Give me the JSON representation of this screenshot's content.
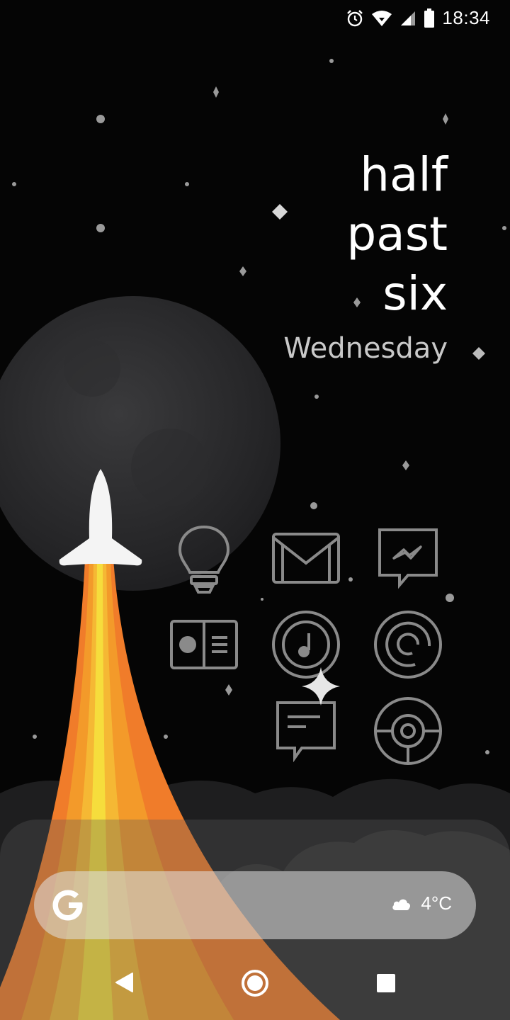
{
  "status_bar": {
    "time": "18:34",
    "icons": [
      "alarm-icon",
      "wifi-icon",
      "cellular-signal-icon",
      "battery-icon"
    ]
  },
  "clock_widget": {
    "lines": [
      "half",
      "past",
      "six"
    ],
    "day": "Wednesday"
  },
  "apps": [
    {
      "name": "keep-notes-icon"
    },
    {
      "name": "gmail-icon"
    },
    {
      "name": "messenger-icon"
    },
    {
      "name": "contacts-card-icon"
    },
    {
      "name": "music-icon"
    },
    {
      "name": "podcasts-icon"
    },
    {
      "name": "messages-icon"
    },
    {
      "name": "camera-icon"
    }
  ],
  "search_bar": {
    "logo": "google-g-logo",
    "weather_icon": "cloud-icon",
    "temperature": "4°C"
  },
  "nav_bar": {
    "buttons": [
      "back-button",
      "home-button",
      "recents-button"
    ]
  },
  "colors": {
    "background": "#050505",
    "icon_stroke": "#8a8a8a",
    "flame_outer": "#f07c2a",
    "flame_mid": "#f5a623",
    "flame_core": "#f6dd3c"
  }
}
